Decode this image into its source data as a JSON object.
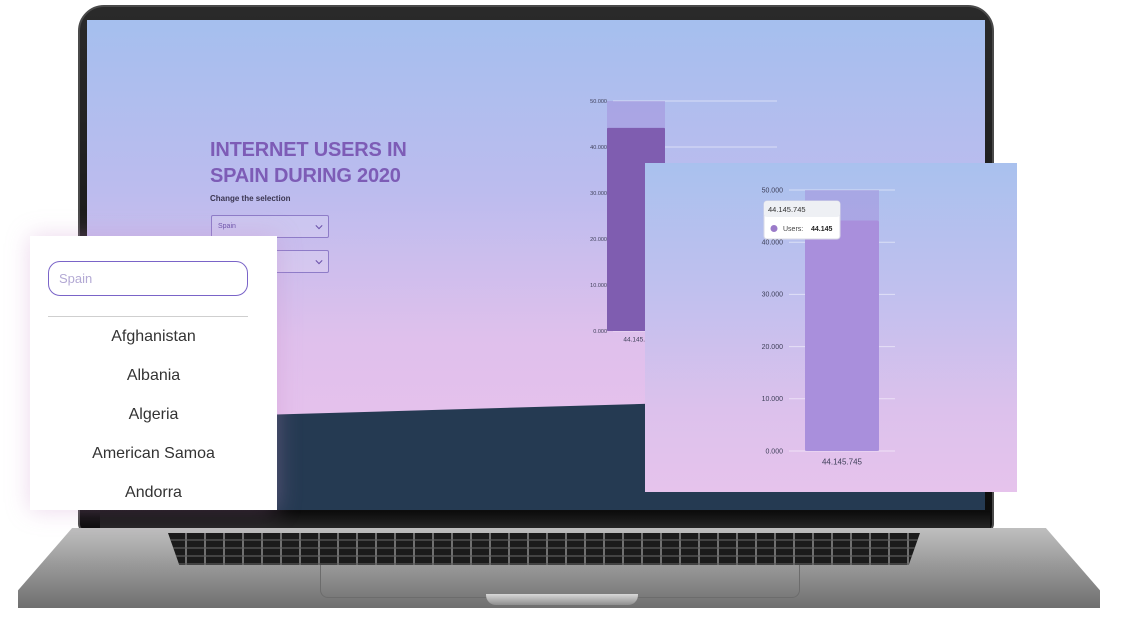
{
  "app": {
    "title_line1": "INTERNET USERS IN",
    "title_line2": "SPAIN DURING 2020",
    "caption": "Change the selection",
    "country_select_value": "Spain",
    "accent_color": "#7d5cb6"
  },
  "dropdown": {
    "search_placeholder": "Spain",
    "items": [
      "Afghanistan",
      "Albania",
      "Algeria",
      "American Samoa",
      "Andorra"
    ]
  },
  "chart_data": [
    {
      "type": "bar",
      "categories": [
        "44.145.745"
      ],
      "values": [
        44145745
      ],
      "ylim": [
        0,
        50000000
      ],
      "y_tick_labels": [
        "0.000",
        "10.000",
        "20.000",
        "30.000",
        "40.000",
        "50.000"
      ],
      "bar_color": "#7f5db0",
      "x_label_visible": "44.145.7"
    },
    {
      "type": "bar",
      "categories": [
        "44.145.745"
      ],
      "values": [
        44145745
      ],
      "ylim": [
        0,
        50000000
      ],
      "y_tick_labels": [
        "0.000",
        "10.000",
        "20.000",
        "30.000",
        "40.000",
        "50.000"
      ],
      "bar_color": "#a98fdc",
      "tooltip": {
        "header": "44.145.745",
        "series_label": "Users:",
        "value_label": "44.145",
        "marker_color": "#9b7bc9"
      }
    }
  ]
}
